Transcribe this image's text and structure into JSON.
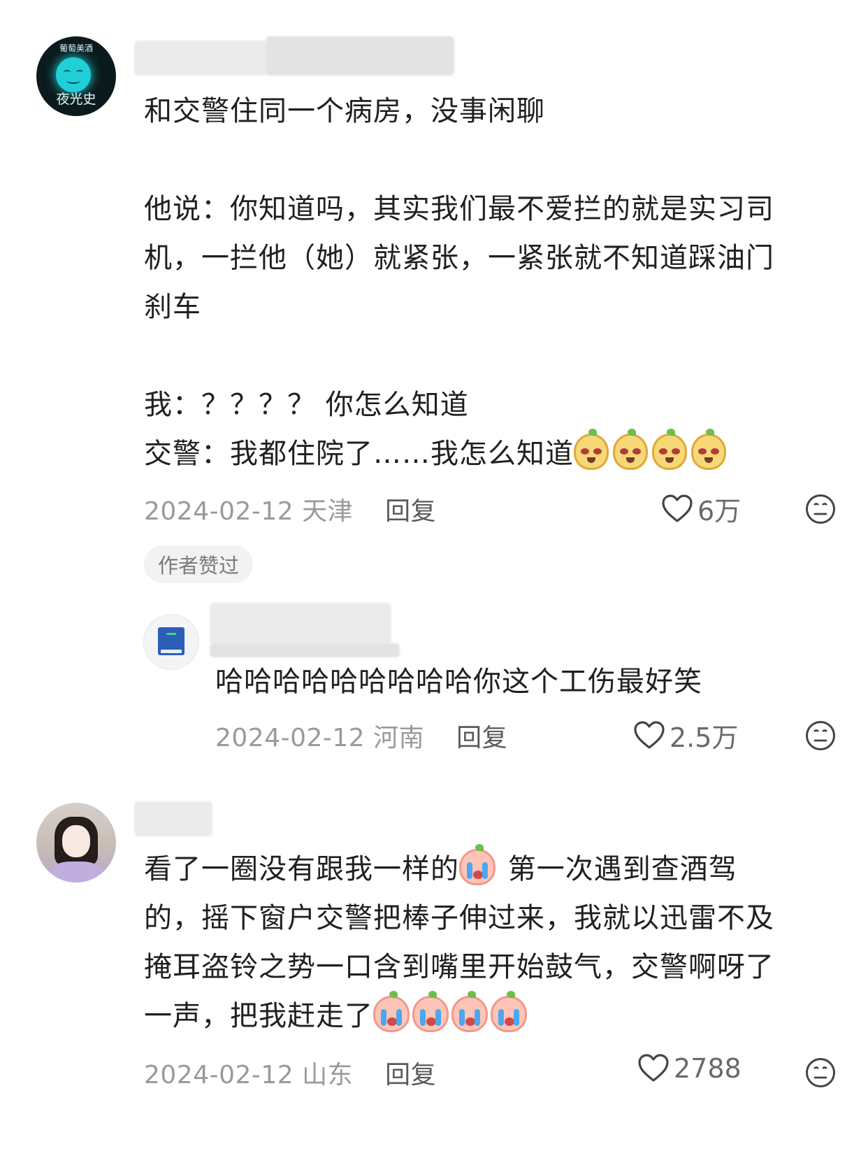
{
  "comments": [
    {
      "avatar": {
        "brand": "葡萄美酒",
        "name": "夜光史"
      },
      "lines": [
        "和交警住同一个病房，没事闲聊",
        "",
        "他说：你知道吗，其实我们最不爱拦的就是实习司",
        "机，一拦他（她）就紧张，一紧张就不知道踩油门",
        "刹车",
        "",
        "我：？？？？ 你怎么知道",
        "交警：我都住院了……我怎么知道"
      ],
      "emoji": "yellow-laugh-emoji",
      "date": "2024-02-12",
      "location": "天津",
      "reply_label": "回复",
      "likes": "6万",
      "badge": "作者赞过"
    },
    {
      "avatar": {
        "icon": "book-icon"
      },
      "text": "哈哈哈哈哈哈哈哈哈你这个工伤最好笑",
      "date": "2024-02-12",
      "location": "河南",
      "reply_label": "回复",
      "likes": "2.5万"
    },
    {
      "avatar": {
        "icon": "user-photo"
      },
      "line1a": "看了一圈没有跟我一样的",
      "line1b": " 第一次遇到查酒驾",
      "line2": "的，摇下窗户交警把棒子伸过来，我就以迅雷不及",
      "line3": "掩耳盗铃之势一口含到嘴里开始鼓气，交警啊呀了",
      "line4": "一声，把我赶走了",
      "emoji": "crying-emoji",
      "date": "2024-02-12",
      "location": "山东",
      "reply_label": "回复",
      "likes": "2788"
    }
  ]
}
